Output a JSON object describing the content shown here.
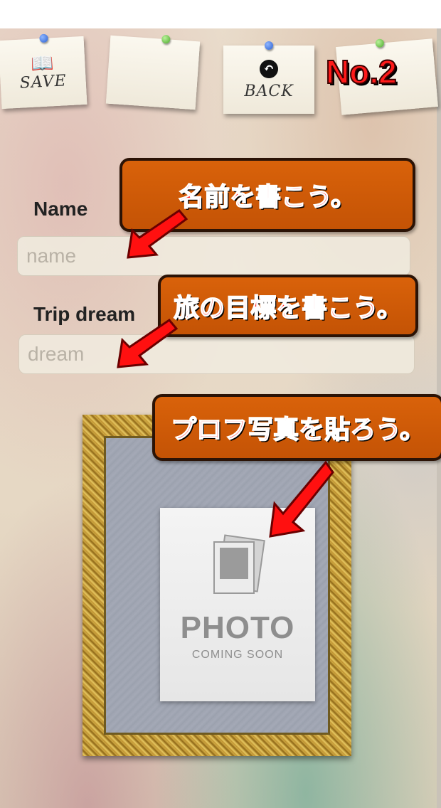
{
  "toolbar": {
    "save_label": "SAVE",
    "back_label": "BACK",
    "page_number": "No.2"
  },
  "form": {
    "name_label": "Name",
    "name_placeholder": "name",
    "dream_label": "Trip dream",
    "dream_placeholder": "dream"
  },
  "annotations": {
    "name_hint": "名前を書こう。",
    "dream_hint": "旅の目標を書こう。",
    "photo_hint": "プロフ写真を貼ろう。"
  },
  "photo": {
    "title": "PHOTO",
    "subtitle": "COMING SOON"
  },
  "icons": {
    "save": "book-icon",
    "back": "back-arrow-icon",
    "photo": "photo-stack-icon"
  },
  "colors": {
    "banner": "#d9620a",
    "annotation_text": "#ff2a2a",
    "arrow": "#ff1010"
  }
}
